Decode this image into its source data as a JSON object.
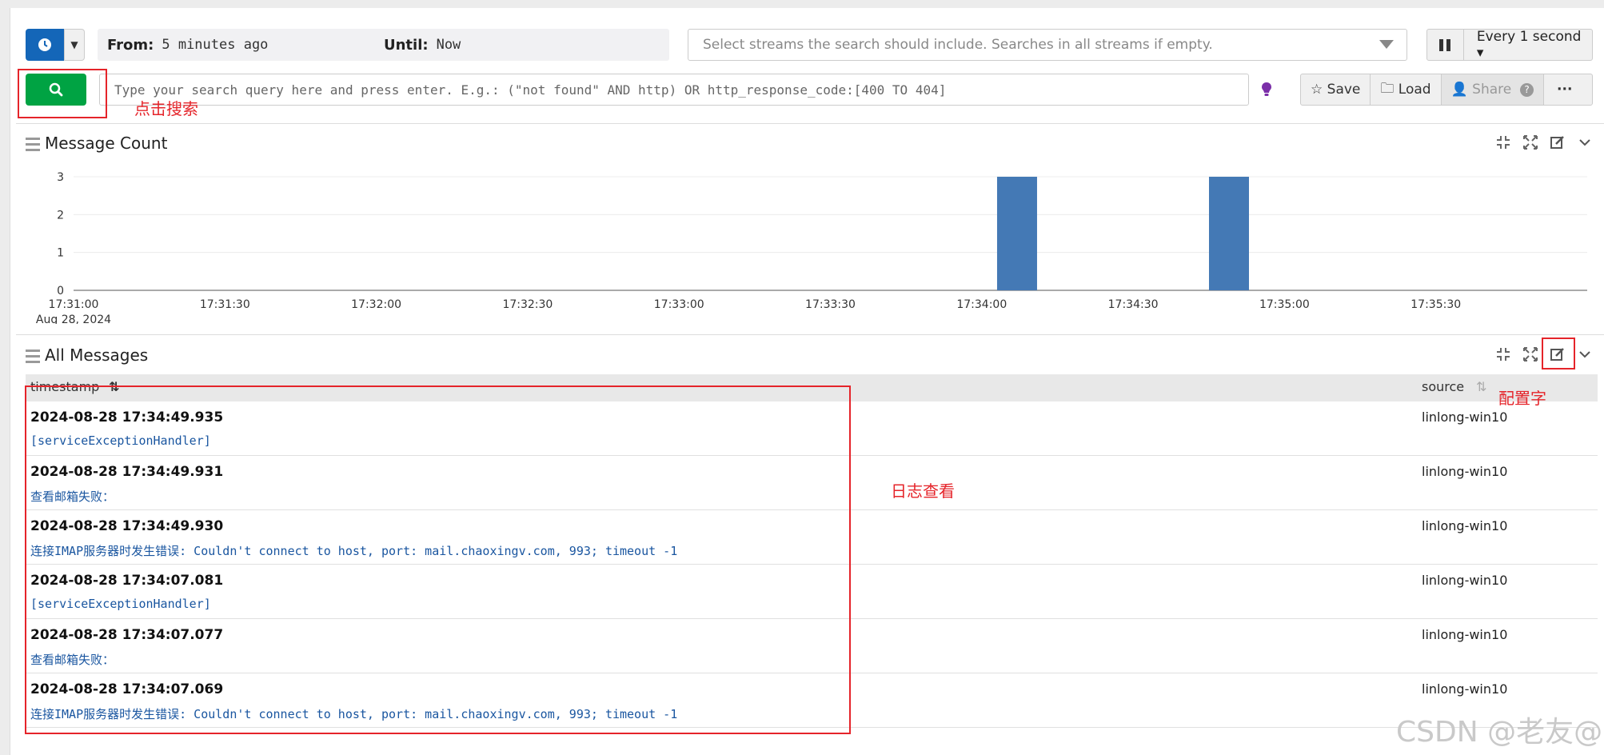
{
  "search": {
    "from_label": "From",
    "from_value": "5 minutes ago",
    "until_label": "Until",
    "until_value": "Now",
    "streams_placeholder": "Select streams the search should include. Searches in all streams if empty.",
    "refresh_label": "Every 1 second",
    "query_placeholder": "Type your search query here and press enter. E.g.: (\"not found\" AND http) OR http_response_code:[400 TO 404]",
    "actions": {
      "save": "Save",
      "load": "Load",
      "share": "Share"
    }
  },
  "annotations": {
    "search_hint": "点击搜索",
    "configure_hint": "配置字",
    "logs_hint": "日志查看"
  },
  "message_count": {
    "title": "Message Count",
    "date_label": "Aug 28, 2024"
  },
  "chart_data": {
    "type": "bar",
    "title": "Message Count",
    "x_ticks": [
      "17:31:00",
      "17:31:30",
      "17:32:00",
      "17:32:30",
      "17:33:00",
      "17:33:30",
      "17:34:00",
      "17:34:30",
      "17:35:00",
      "17:35:30"
    ],
    "y_ticks": [
      0,
      1,
      2,
      3
    ],
    "ylim": [
      0,
      3
    ],
    "x_range": [
      "17:31:00",
      "17:36:00"
    ],
    "bars": [
      {
        "x": "17:34:07",
        "value": 3
      },
      {
        "x": "17:34:49",
        "value": 3
      }
    ],
    "color": "#4479b5",
    "grid": true
  },
  "all_messages": {
    "title": "All Messages",
    "columns": {
      "timestamp": "timestamp",
      "source": "source"
    },
    "rows": [
      {
        "timestamp": "2024-08-28 17:34:49.935",
        "message": "[serviceExceptionHandler]",
        "source": "linlong-win10"
      },
      {
        "timestamp": "2024-08-28 17:34:49.931",
        "message": "查看邮箱失败：",
        "source": "linlong-win10"
      },
      {
        "timestamp": "2024-08-28 17:34:49.930",
        "message": "连接IMAP服务器时发生错误: Couldn't connect to host, port: mail.chaoxingv.com, 993; timeout -1",
        "source": "linlong-win10"
      },
      {
        "timestamp": "2024-08-28 17:34:07.081",
        "message": "[serviceExceptionHandler]",
        "source": "linlong-win10"
      },
      {
        "timestamp": "2024-08-28 17:34:07.077",
        "message": "查看邮箱失败：",
        "source": "linlong-win10"
      },
      {
        "timestamp": "2024-08-28 17:34:07.069",
        "message": "连接IMAP服务器时发生错误: Couldn't connect to host, port: mail.chaoxingv.com, 993; timeout -1",
        "source": "linlong-win10"
      }
    ]
  },
  "watermark": "CSDN @老友@"
}
